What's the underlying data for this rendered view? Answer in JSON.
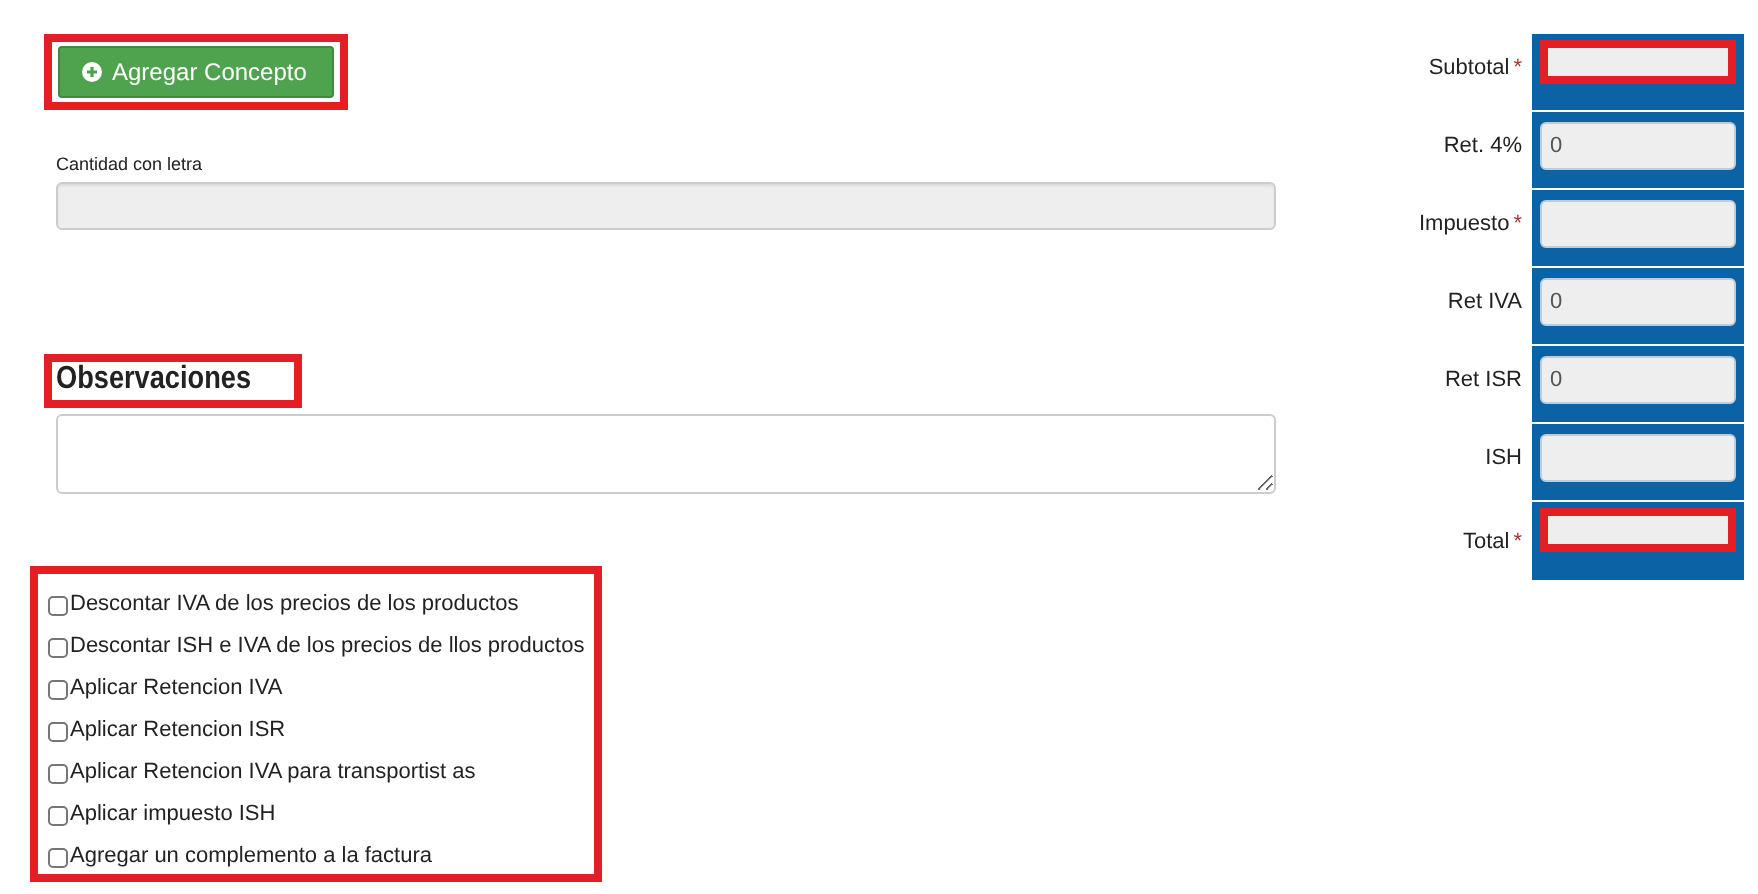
{
  "add_button": {
    "label": "Agregar Concepto",
    "highlighted": true
  },
  "amount_in_words": {
    "label": "Cantidad con letra",
    "disabled": true
  },
  "observations": {
    "heading": "Observaciones",
    "highlighted": true
  },
  "options": {
    "highlighted": true,
    "items": [
      {
        "label": "Descontar IVA de los precios de los productos",
        "checked": false
      },
      {
        "label": "Descontar ISH e IVA de los precios de llos productos",
        "checked": false
      },
      {
        "label": "Aplicar Retencion IVA",
        "checked": false
      },
      {
        "label": "Aplicar Retencion ISR",
        "checked": false
      },
      {
        "label": "Aplicar Retencion IVA para transportist as",
        "checked": false
      },
      {
        "label": "Aplicar impuesto ISH",
        "checked": false
      },
      {
        "label": "Agregar un complemento a la factura",
        "checked": false
      }
    ]
  },
  "totals": [
    {
      "label": "Subtotal",
      "required_mark": "*",
      "highlighted": true
    },
    {
      "label": "Ret. 4%",
      "value": "0",
      "highlighted": false
    },
    {
      "label": "Impuesto",
      "required_mark": "*",
      "highlighted": false
    },
    {
      "label": "Ret IVA",
      "value": "0",
      "highlighted": false
    },
    {
      "label": "Ret ISR",
      "value": "0",
      "highlighted": false
    },
    {
      "label": "ISH",
      "highlighted": false
    },
    {
      "label": "Total",
      "required_mark": "*",
      "highlighted": true
    }
  ]
}
